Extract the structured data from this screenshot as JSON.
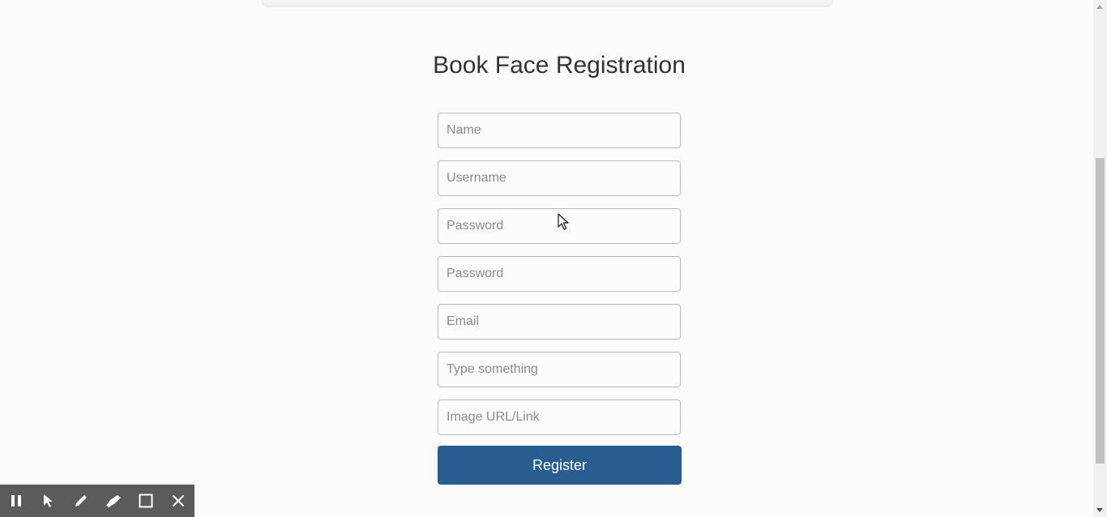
{
  "page": {
    "title": "Book Face Registration"
  },
  "form": {
    "fields": [
      {
        "placeholder": "Name",
        "type": "text"
      },
      {
        "placeholder": "Username",
        "type": "text"
      },
      {
        "placeholder": "Password",
        "type": "password"
      },
      {
        "placeholder": "Password",
        "type": "password"
      },
      {
        "placeholder": "Email",
        "type": "email"
      },
      {
        "placeholder": "Type something",
        "type": "text"
      },
      {
        "placeholder": "Image URL/Link",
        "type": "text"
      }
    ],
    "submit_label": "Register"
  },
  "toolbar": {
    "tools": [
      "pause-icon",
      "pointer-icon",
      "pen-icon",
      "highlighter-icon",
      "rectangle-icon",
      "close-icon"
    ]
  },
  "colors": {
    "accent": "#295d92",
    "background": "#fcfcfc",
    "toolbar": "#5b5b5b"
  }
}
